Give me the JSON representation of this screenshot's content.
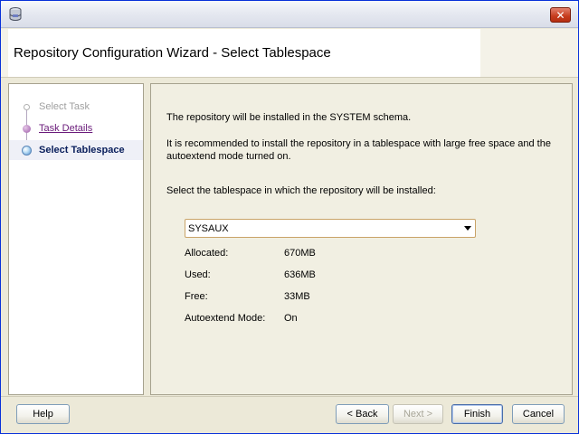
{
  "window": {
    "title": "Repository Configuration Wizard - Select Tablespace",
    "close_glyph": "✕",
    "app_icon": "app-cylinder-icon"
  },
  "nav": {
    "items": [
      {
        "label": "Select Task",
        "state": "done"
      },
      {
        "label": "Task Details",
        "state": "visited"
      },
      {
        "label": "Select Tablespace",
        "state": "current"
      }
    ]
  },
  "content": {
    "intro": "The repository will be installed in the SYSTEM schema.",
    "recommend": "It is recommended to install the repository in a tablespace with large free space and the autoextend mode turned on.",
    "prompt": "Select the tablespace in which the repository will be installed:",
    "tablespace": {
      "selected": "SYSAUX"
    },
    "details": [
      {
        "label": "Allocated:",
        "value": "670MB"
      },
      {
        "label": "Used:",
        "value": "636MB"
      },
      {
        "label": "Free:",
        "value": "33MB"
      },
      {
        "label": "Autoextend Mode:",
        "value": "On"
      }
    ]
  },
  "footer": {
    "help": "Help",
    "back": "< Back",
    "next": "Next >",
    "finish": "Finish",
    "cancel": "Cancel"
  },
  "colors": {
    "window_bg": "#ece9d8",
    "nav_current": "#0a1f5c",
    "nav_visited": "#6a1b7a"
  }
}
